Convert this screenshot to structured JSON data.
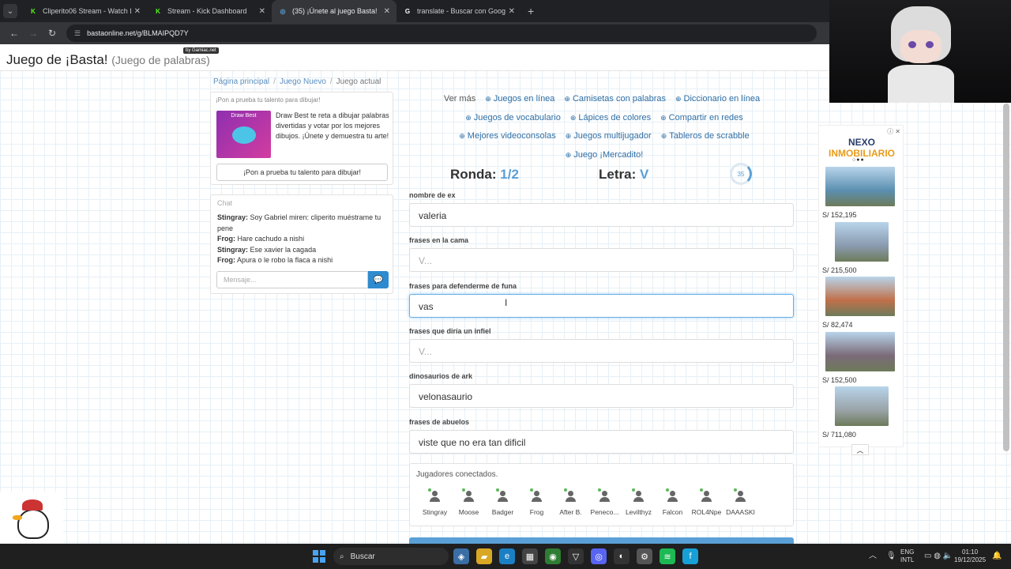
{
  "browser": {
    "tabs": [
      {
        "title": "Cliperito06 Stream - Watch Live",
        "fav": "K",
        "color": "#53fc18",
        "active": false
      },
      {
        "title": "Stream - Kick Dashboard",
        "fav": "K",
        "color": "#53fc18",
        "active": false
      },
      {
        "title": "(35) ¡Únete al juego Basta!",
        "fav": "◎",
        "color": "#5aa0d6",
        "active": true
      },
      {
        "title": "translate - Buscar con Google",
        "fav": "G",
        "color": "#ffffff",
        "active": false
      }
    ],
    "url": "bastaonline.net/g/BLMAIPQD7Y"
  },
  "site": {
    "title": "Juego de ¡Basta!",
    "subtitle": "(Juego de palabras)",
    "badge": "by Gamiac.net"
  },
  "breadcrumb": {
    "home": "Página principal",
    "new": "Juego Nuevo",
    "current": "Juego actual"
  },
  "draw": {
    "heading": "¡Pon a prueba tu talento para dibujar!",
    "img_label": "Draw Best",
    "text": "Draw Best te reta a dibujar palabras divertidas y votar por los mejores dibujos. ¡Únete y demuestra tu arte!",
    "button": "¡Pon a prueba tu talento para dibujar!"
  },
  "chat": {
    "title": "Chat",
    "messages": [
      {
        "user": "Stingray:",
        "text": "Soy Gabriel miren: cliperito muéstrame tu pene"
      },
      {
        "user": "Frog:",
        "text": "Hare cachudo a nishi"
      },
      {
        "user": "Stingray:",
        "text": "Ese xavier la cagada"
      },
      {
        "user": "Frog:",
        "text": "Apura o le robo la flaca a nishi"
      }
    ],
    "placeholder": "Mensaje..."
  },
  "links": {
    "label": "Ver más",
    "items": [
      "Juegos en línea",
      "Camisetas con palabras",
      "Diccionario en línea",
      "Juegos de vocabulario",
      "Lápices de colores",
      "Compartir en redes",
      "Mejores videoconsolas",
      "Juegos multijugador",
      "Tableros de scrabble",
      "Juego ¡Mercadito!"
    ]
  },
  "round": {
    "label": "Ronda:",
    "value": "1/2"
  },
  "letter": {
    "label": "Letra:",
    "value": "V"
  },
  "timer": "35",
  "fields": [
    {
      "label": "nombre de ex",
      "value": "valeria",
      "placeholder": ""
    },
    {
      "label": "frases en la cama",
      "value": "",
      "placeholder": "V..."
    },
    {
      "label": "frases para defenderme de funa",
      "value": "vas",
      "placeholder": ""
    },
    {
      "label": "frases que diría un infiel",
      "value": "",
      "placeholder": "V..."
    },
    {
      "label": "dinosaurios de ark",
      "value": "velonasaurio",
      "placeholder": ""
    },
    {
      "label": "frases de abuelos",
      "value": "viste que no era tan dificil",
      "placeholder": ""
    }
  ],
  "players": {
    "heading": "Jugadores conectados.",
    "list": [
      "Stingray",
      "Moose",
      "Badger",
      "Frog",
      "After B.",
      "Peneco...",
      "Levilthyz",
      "Falcon",
      "ROL4Npe",
      "DAAASKI"
    ]
  },
  "ad": {
    "logo_a": "NEXO",
    "logo_b": "INMOBILIARIO",
    "prices": [
      "S/ 152,195",
      "S/ 215,500",
      "S/ 82,474",
      "S/ 152,500",
      "S/ 711,080"
    ]
  },
  "taskbar": {
    "search": "Buscar",
    "lang1": "ENG",
    "lang2": "INTL",
    "time": "01:10",
    "date": "19/12/2025"
  }
}
